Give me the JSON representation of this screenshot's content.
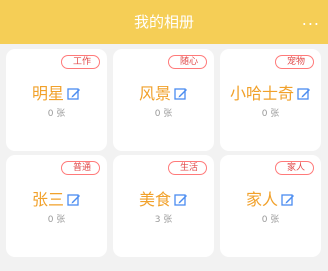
{
  "header": {
    "title": "我的相册",
    "more_label": "..."
  },
  "albums": [
    {
      "tag": "工作",
      "name": "明星",
      "count": "0 张"
    },
    {
      "tag": "随心",
      "name": "风景",
      "count": "0 张"
    },
    {
      "tag": "宠物",
      "name": "小哈士奇",
      "count": "0 张"
    },
    {
      "tag": "普通",
      "name": "张三",
      "count": "0 张"
    },
    {
      "tag": "生活",
      "name": "美食",
      "count": "3 张"
    },
    {
      "tag": "家人",
      "name": "家人",
      "count": "0 张"
    }
  ],
  "colors": {
    "header_bg": "#f5ce56",
    "album_name": "#f1a12b",
    "tag_border": "#ff7a7a",
    "edit_icon": "#4a8cf0"
  }
}
